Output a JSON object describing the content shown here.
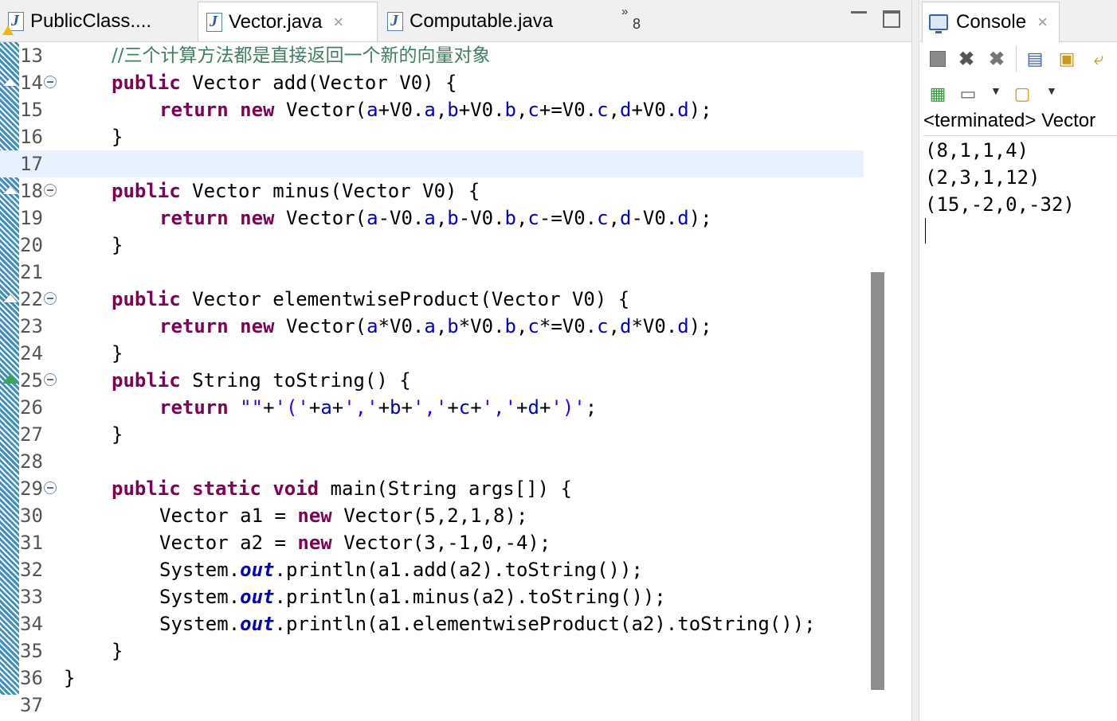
{
  "editor": {
    "tabs": [
      {
        "label": "PublicClass....",
        "active": false,
        "has_warning": true
      },
      {
        "label": "Vector.java",
        "active": true,
        "close": "×"
      },
      {
        "label": "Computable.java",
        "active": false
      }
    ],
    "overflow": {
      "glyph": "»",
      "count": "8"
    },
    "lines": [
      {
        "num": "13",
        "kind": "comment",
        "text": "//三个计算方法都是直接返回一个新的向量对象"
      },
      {
        "num": "14",
        "marker": "override",
        "fold": true,
        "parts": [
          {
            "t": "public",
            "c": "kw"
          },
          {
            "t": " Vector add(Vector V0) {",
            "c": ""
          }
        ]
      },
      {
        "num": "15",
        "parts": [
          {
            "t": "return",
            "c": "kw",
            "indent": "    "
          },
          {
            "t": " ",
            "c": ""
          },
          {
            "t": "new",
            "c": "kw"
          },
          {
            "t": " Vector(",
            "c": ""
          },
          {
            "t": "a",
            "c": "fld"
          },
          {
            "t": "+V0.",
            "c": ""
          },
          {
            "t": "a",
            "c": "fld"
          },
          {
            "t": ",",
            "c": ""
          },
          {
            "t": "b",
            "c": "fld"
          },
          {
            "t": "+V0.",
            "c": ""
          },
          {
            "t": "b",
            "c": "fld"
          },
          {
            "t": ",",
            "c": ""
          },
          {
            "t": "c",
            "c": "fld"
          },
          {
            "t": "+=V0.",
            "c": ""
          },
          {
            "t": "c",
            "c": "fld"
          },
          {
            "t": ",",
            "c": ""
          },
          {
            "t": "d",
            "c": "fld"
          },
          {
            "t": "+V0.",
            "c": ""
          },
          {
            "t": "d",
            "c": "fld"
          },
          {
            "t": ");",
            "c": ""
          }
        ]
      },
      {
        "num": "16",
        "parts": [
          {
            "t": "}",
            "c": ""
          }
        ]
      },
      {
        "num": "17",
        "current": true,
        "parts": []
      },
      {
        "num": "18",
        "marker": "override",
        "fold": true,
        "parts": [
          {
            "t": "public",
            "c": "kw"
          },
          {
            "t": " Vector minus(Vector V0) {",
            "c": ""
          }
        ]
      },
      {
        "num": "19",
        "parts": [
          {
            "t": "return",
            "c": "kw",
            "indent": "    "
          },
          {
            "t": " ",
            "c": ""
          },
          {
            "t": "new",
            "c": "kw"
          },
          {
            "t": " Vector(",
            "c": ""
          },
          {
            "t": "a",
            "c": "fld"
          },
          {
            "t": "-V0.",
            "c": ""
          },
          {
            "t": "a",
            "c": "fld"
          },
          {
            "t": ",",
            "c": ""
          },
          {
            "t": "b",
            "c": "fld"
          },
          {
            "t": "-V0.",
            "c": ""
          },
          {
            "t": "b",
            "c": "fld"
          },
          {
            "t": ",",
            "c": ""
          },
          {
            "t": "c",
            "c": "fld"
          },
          {
            "t": "-=V0.",
            "c": ""
          },
          {
            "t": "c",
            "c": "fld"
          },
          {
            "t": ",",
            "c": ""
          },
          {
            "t": "d",
            "c": "fld"
          },
          {
            "t": "-V0.",
            "c": ""
          },
          {
            "t": "d",
            "c": "fld"
          },
          {
            "t": ");",
            "c": ""
          }
        ]
      },
      {
        "num": "20",
        "parts": [
          {
            "t": "}",
            "c": ""
          }
        ]
      },
      {
        "num": "21",
        "parts": []
      },
      {
        "num": "22",
        "marker": "override",
        "fold": true,
        "parts": [
          {
            "t": "public",
            "c": "kw"
          },
          {
            "t": " Vector elementwiseProduct(Vector V0) {",
            "c": ""
          }
        ]
      },
      {
        "num": "23",
        "parts": [
          {
            "t": "return",
            "c": "kw",
            "indent": "    "
          },
          {
            "t": " ",
            "c": ""
          },
          {
            "t": "new",
            "c": "kw"
          },
          {
            "t": " Vector(",
            "c": ""
          },
          {
            "t": "a",
            "c": "fld"
          },
          {
            "t": "*V0.",
            "c": ""
          },
          {
            "t": "a",
            "c": "fld"
          },
          {
            "t": ",",
            "c": ""
          },
          {
            "t": "b",
            "c": "fld"
          },
          {
            "t": "*V0.",
            "c": ""
          },
          {
            "t": "b",
            "c": "fld"
          },
          {
            "t": ",",
            "c": ""
          },
          {
            "t": "c",
            "c": "fld"
          },
          {
            "t": "*=V0.",
            "c": ""
          },
          {
            "t": "c",
            "c": "fld"
          },
          {
            "t": ",",
            "c": ""
          },
          {
            "t": "d",
            "c": "fld"
          },
          {
            "t": "*V0.",
            "c": ""
          },
          {
            "t": "d",
            "c": "fld"
          },
          {
            "t": ");",
            "c": ""
          }
        ]
      },
      {
        "num": "24",
        "parts": [
          {
            "t": "}",
            "c": ""
          }
        ]
      },
      {
        "num": "25",
        "marker": "implements",
        "fold": true,
        "parts": [
          {
            "t": "public",
            "c": "kw"
          },
          {
            "t": " String toString() {",
            "c": ""
          }
        ]
      },
      {
        "num": "26",
        "parts": [
          {
            "t": "return",
            "c": "kw",
            "indent": "    "
          },
          {
            "t": " ",
            "c": ""
          },
          {
            "t": "\"\"",
            "c": "str"
          },
          {
            "t": "+",
            "c": ""
          },
          {
            "t": "'('",
            "c": "str"
          },
          {
            "t": "+",
            "c": ""
          },
          {
            "t": "a",
            "c": "fld"
          },
          {
            "t": "+",
            "c": ""
          },
          {
            "t": "','",
            "c": "str"
          },
          {
            "t": "+",
            "c": ""
          },
          {
            "t": "b",
            "c": "fld"
          },
          {
            "t": "+",
            "c": ""
          },
          {
            "t": "','",
            "c": "str"
          },
          {
            "t": "+",
            "c": ""
          },
          {
            "t": "c",
            "c": "fld"
          },
          {
            "t": "+",
            "c": ""
          },
          {
            "t": "','",
            "c": "str"
          },
          {
            "t": "+",
            "c": ""
          },
          {
            "t": "d",
            "c": "fld"
          },
          {
            "t": "+",
            "c": ""
          },
          {
            "t": "')'",
            "c": "str"
          },
          {
            "t": ";",
            "c": ""
          }
        ]
      },
      {
        "num": "27",
        "parts": [
          {
            "t": "}",
            "c": ""
          }
        ]
      },
      {
        "num": "28",
        "parts": []
      },
      {
        "num": "29",
        "fold": true,
        "parts": [
          {
            "t": "public",
            "c": "kw"
          },
          {
            "t": " ",
            "c": ""
          },
          {
            "t": "static",
            "c": "kw"
          },
          {
            "t": " ",
            "c": ""
          },
          {
            "t": "void",
            "c": "kw"
          },
          {
            "t": " main(String args[]) {",
            "c": ""
          }
        ]
      },
      {
        "num": "30",
        "parts": [
          {
            "t": "Vector a1 = ",
            "c": "",
            "indent": "    "
          },
          {
            "t": "new",
            "c": "kw"
          },
          {
            "t": " Vector(5,2,1,8);",
            "c": ""
          }
        ]
      },
      {
        "num": "31",
        "parts": [
          {
            "t": "Vector a2 = ",
            "c": "",
            "indent": "    "
          },
          {
            "t": "new",
            "c": "kw"
          },
          {
            "t": " Vector(3,-1,0,-4);",
            "c": ""
          }
        ]
      },
      {
        "num": "32",
        "parts": [
          {
            "t": "System.",
            "c": "",
            "indent": "    "
          },
          {
            "t": "out",
            "c": "sfld"
          },
          {
            "t": ".println(a1.add(a2).toString());",
            "c": ""
          }
        ]
      },
      {
        "num": "33",
        "parts": [
          {
            "t": "System.",
            "c": "",
            "indent": "    "
          },
          {
            "t": "out",
            "c": "sfld"
          },
          {
            "t": ".println(a1.minus(a2).toString());",
            "c": ""
          }
        ]
      },
      {
        "num": "34",
        "parts": [
          {
            "t": "System.",
            "c": "",
            "indent": "    "
          },
          {
            "t": "out",
            "c": "sfld"
          },
          {
            "t": ".println(a1.elementwiseProduct(a2).toString());",
            "c": ""
          }
        ]
      },
      {
        "num": "35",
        "parts": [
          {
            "t": "}",
            "c": ""
          }
        ]
      },
      {
        "num": "36",
        "parts": [
          {
            "t": "}",
            "c": "",
            "outer": true
          }
        ]
      },
      {
        "num": "37",
        "parts": []
      }
    ]
  },
  "console": {
    "tab_label": "Console",
    "tab_close": "×",
    "launch_label": "<terminated> Vector",
    "output": [
      "(8,1,1,4)",
      "(2,3,1,12)",
      "(15,-2,0,-32)"
    ]
  },
  "colors": {
    "keyword": "#7f0055",
    "field": "#0000c0",
    "string": "#2a00ff",
    "comment": "#3f7f5f",
    "current_line": "#e8f2fe"
  }
}
